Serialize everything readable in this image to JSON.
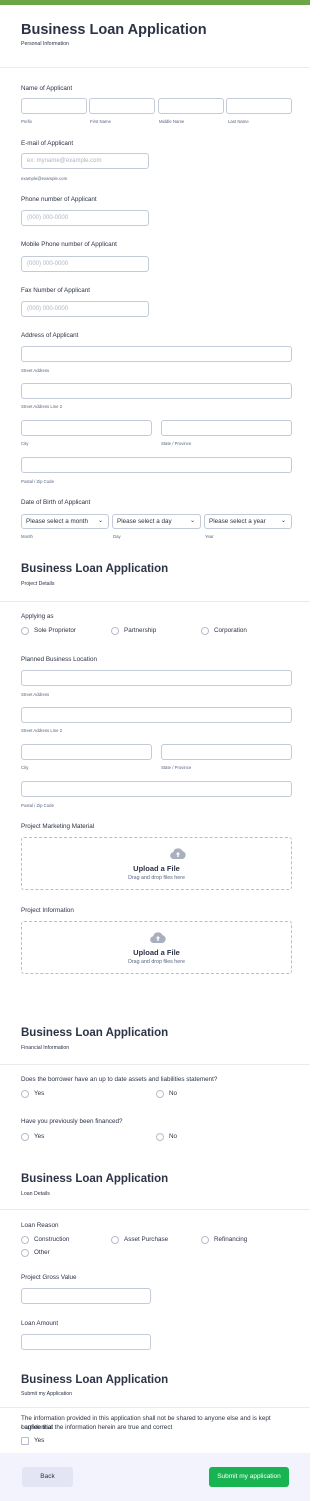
{
  "colors": {
    "accent_top": "#6ba548",
    "submit": "#18b451",
    "footer_bg": "#f3f3fe"
  },
  "section1": {
    "title": "Business Loan Application",
    "subtitle": "Personal Information",
    "name": {
      "label": "Name of Applicant",
      "sub": [
        "Prefix",
        "First Name",
        "Middle Name",
        "Last Name"
      ]
    },
    "email": {
      "label": "E-mail of Applicant",
      "placeholder": "ex: myname@example.com",
      "sub": "example@example.com"
    },
    "phone": {
      "label": "Phone number of Applicant",
      "placeholder": "(000) 000-0000"
    },
    "mobile": {
      "label": "Mobile Phone number of Applicant",
      "placeholder": "(000) 000-0000"
    },
    "fax": {
      "label": "Fax Number of Applicant",
      "placeholder": "(000) 000-0000"
    },
    "address": {
      "label": "Address of Applicant",
      "street": "Street Address",
      "street2": "Street Address Line 2",
      "city": "City",
      "state": "State / Province",
      "postal": "Postal / Zip Code"
    },
    "dob": {
      "label": "Date of Birth of Applicant",
      "month": "Please select a month",
      "day": "Please select a day",
      "year": "Please select a year",
      "sub_month": "Month",
      "sub_day": "Day",
      "sub_year": "Year"
    }
  },
  "section2": {
    "title": "Business Loan Application",
    "subtitle": "Project Details",
    "applying": {
      "label": "Applying as",
      "options": [
        "Sole Proprietor",
        "Partnership",
        "Corporation"
      ]
    },
    "location": {
      "label": "Planned Business Location",
      "street": "Street Address",
      "street2": "Street Address Line 2",
      "city": "City",
      "state": "State / Province",
      "postal": "Postal / Zip Code"
    },
    "marketing": {
      "label": "Project Marketing Material",
      "upload_title": "Upload a File",
      "upload_sub": "Drag and drop files here"
    },
    "info": {
      "label": "Project Information",
      "upload_title": "Upload a File",
      "upload_sub": "Drag and drop files here"
    }
  },
  "section3": {
    "title": "Business Loan Application",
    "subtitle": "Financial Information",
    "q1": {
      "label": "Does the borrower have an up to date assets and liabilities statement?",
      "yes": "Yes",
      "no": "No"
    },
    "q2": {
      "label": "Have you previously been financed?",
      "yes": "Yes",
      "no": "No"
    }
  },
  "section4": {
    "title": "Business Loan Application",
    "subtitle": "Loan Details",
    "reason": {
      "label": "Loan Reason",
      "options": [
        "Construction",
        "Asset Purchase",
        "Refinancing",
        "Other"
      ]
    },
    "gross": {
      "label": "Project Gross Value"
    },
    "amount": {
      "label": "Loan Amount"
    }
  },
  "section5": {
    "title": "Business Loan Application",
    "subtitle": "Submit my Application",
    "notice": "The information provided in this application shall not be shared to anyone else and is kept confidential",
    "agree": {
      "label": "I agree that the information herein are true and correct",
      "yes": "Yes"
    }
  },
  "footer": {
    "back": "Back",
    "submit": "Submit my application"
  }
}
